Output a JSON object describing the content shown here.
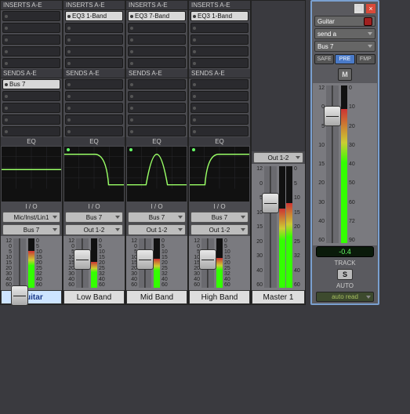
{
  "channels": [
    {
      "name": "Guitar",
      "selected": true,
      "inserts_label": "INSERTS A-E",
      "inserts": [
        "",
        "",
        "",
        "",
        ""
      ],
      "sends_label": "SENDS A-E",
      "sends": [
        "Bus 7",
        "",
        "",
        "",
        ""
      ],
      "eq_label": "EQ",
      "eq_curve": "flat",
      "io_label": "I / O",
      "input": "Mic/Inst/Lin1",
      "output": "Bus 7",
      "fader_pos": 0.96,
      "meter_level": 0.75
    },
    {
      "name": "Low Band",
      "selected": false,
      "inserts_label": "INSERTS A-E",
      "inserts": [
        "EQ3 1-Band",
        "",
        "",
        "",
        ""
      ],
      "sends_label": "SENDS A-E",
      "sends": [
        "",
        "",
        "",
        "",
        ""
      ],
      "eq_label": "EQ",
      "eq_curve": "lowpass",
      "io_label": "I / O",
      "input": "Bus 7",
      "output": "Out 1-2",
      "fader_pos": 0.23,
      "meter_level": 0.52
    },
    {
      "name": "Mid Band",
      "selected": false,
      "inserts_label": "INSERTS A-E",
      "inserts": [
        "EQ3 7-Band",
        "",
        "",
        "",
        ""
      ],
      "sends_label": "SENDS A-E",
      "sends": [
        "",
        "",
        "",
        "",
        ""
      ],
      "eq_label": "EQ",
      "eq_curve": "bandpass",
      "io_label": "I / O",
      "input": "Bus 7",
      "output": "Out 1-2",
      "fader_pos": 0.23,
      "meter_level": 0.58
    },
    {
      "name": "High Band",
      "selected": false,
      "inserts_label": "INSERTS A-E",
      "inserts": [
        "EQ3 1-Band",
        "",
        "",
        "",
        ""
      ],
      "sends_label": "SENDS A-E",
      "sends": [
        "",
        "",
        "",
        "",
        ""
      ],
      "eq_label": "EQ",
      "eq_curve": "highpass",
      "io_label": "I / O",
      "input": "Bus 7",
      "output": "Out 1-2",
      "fader_pos": 0.23,
      "meter_level": 0.6
    }
  ],
  "master": {
    "name": "Master 1",
    "output": "Out 1-2",
    "fader_pos": 0.22,
    "meters": [
      0.65,
      0.7
    ]
  },
  "scale_left": [
    "12",
    "0",
    "5",
    "10",
    "15",
    "20",
    "30",
    "40",
    "60"
  ],
  "scale_right": [
    "0",
    "5",
    "10",
    "15",
    "20",
    "25",
    "32",
    "40",
    "60"
  ],
  "narrow": {
    "track_name": "Guitar",
    "send_name": "send a",
    "send_bus": "Bus 7",
    "buttons": {
      "safe": "SAFE",
      "pre": "PRE",
      "fmp": "FMP"
    },
    "m_btn": "M",
    "scale_left": [
      "12",
      "0",
      "5",
      "10",
      "15",
      "20",
      "30",
      "40",
      "60"
    ],
    "scale_right": [
      "0",
      "10",
      "20",
      "30",
      "40",
      "50",
      "60",
      "72",
      "90"
    ],
    "fader_pos": 0.13,
    "meter_level": 0.85,
    "readout": "-0.4",
    "track_label": "TRACK",
    "s_btn": "S",
    "auto_label": "AUTO",
    "auto_mode": "auto read"
  }
}
